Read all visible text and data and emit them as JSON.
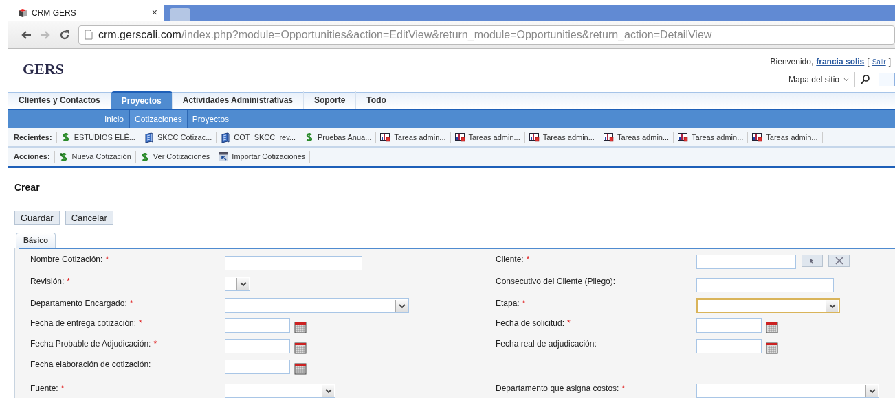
{
  "browser": {
    "tab_title": "CRM GERS",
    "tab_close": "×",
    "url_host": "crm.gerscali.com",
    "url_path": "/index.php?module=Opportunities&action=EditView&return_module=Opportunities&return_action=DetailView"
  },
  "header": {
    "logo": "GERS",
    "welcome": "Bienvenido,",
    "user": "francia solis",
    "bracket_open": "[",
    "logout": "Salir",
    "bracket_close": "]",
    "site_map": "Mapa del sitio"
  },
  "main_tabs": [
    {
      "label": "Clientes y Contactos",
      "selected": false
    },
    {
      "label": "Proyectos",
      "selected": true
    },
    {
      "label": "Actividades Administrativas",
      "selected": false
    },
    {
      "label": "Soporte",
      "selected": false
    },
    {
      "label": "Todo",
      "selected": false
    }
  ],
  "sub_tabs": [
    {
      "label": "Inicio",
      "selected": false
    },
    {
      "label": "Cotizaciones",
      "selected": true
    },
    {
      "label": "Proyectos",
      "selected": false
    }
  ],
  "recent": {
    "label": "Recientes:",
    "items": [
      {
        "kind": "quote",
        "label": "ESTUDIOS ELÉ..."
      },
      {
        "kind": "project",
        "label": "SKCC Cotizac..."
      },
      {
        "kind": "project",
        "label": "COT_SKCC_rev..."
      },
      {
        "kind": "quote",
        "label": "Pruebas Anua..."
      },
      {
        "kind": "task",
        "label": "Tareas admin..."
      },
      {
        "kind": "task",
        "label": "Tareas admin..."
      },
      {
        "kind": "task",
        "label": "Tareas admin..."
      },
      {
        "kind": "task",
        "label": "Tareas admin..."
      },
      {
        "kind": "task",
        "label": "Tareas admin..."
      },
      {
        "kind": "task",
        "label": "Tareas admin..."
      }
    ]
  },
  "actions": {
    "label": "Acciones:",
    "items": [
      {
        "kind": "new",
        "label": "Nueva Cotización"
      },
      {
        "kind": "quote",
        "label": "Ver Cotizaciones"
      },
      {
        "kind": "import",
        "label": "Importar Cotizaciones"
      }
    ]
  },
  "page_title": "Crear",
  "buttons": [
    "Guardar",
    "Cancelar"
  ],
  "form_tabs": [
    {
      "label": "Básico",
      "selected": true
    }
  ],
  "rows": [
    {
      "left": {
        "label": "Nombre Cotización:",
        "required_mark": "*",
        "kind": "text",
        "focused": false
      },
      "right": {
        "label": "Cliente:",
        "required_mark": "*",
        "kind": "relate",
        "focused": false
      }
    },
    {
      "left": {
        "label": "Revisión:",
        "required_mark": "*",
        "kind": "select",
        "focused": false
      },
      "right": {
        "label": "Consecutivo del Cliente (Pliego):",
        "kind": "text",
        "focused": false
      }
    },
    {
      "left": {
        "label": "Departamento Encargado:",
        "required_mark": "*",
        "kind": "select",
        "focused": false
      },
      "right": {
        "label": "Etapa:",
        "required_mark": "*",
        "kind": "select",
        "focused": true
      }
    },
    {
      "left": {
        "label": "Fecha de entrega cotización:",
        "required_mark": "*",
        "kind": "date",
        "focused": false
      },
      "right": {
        "label": "Fecha de solicitud:",
        "required_mark": "*",
        "kind": "date",
        "focused": false
      }
    },
    {
      "left": {
        "label": "Fecha Probable de Adjudicación:",
        "required_mark": "*",
        "kind": "date",
        "focused": false
      },
      "right": {
        "label": "Fecha real de adjudicación:",
        "kind": "date",
        "focused": false
      }
    },
    {
      "left": {
        "label": "Fecha elaboración de cotización:",
        "kind": "date",
        "focused": false
      }
    },
    {
      "left": {
        "label": "Fuente:",
        "required_mark": "*",
        "kind": "select",
        "focused": false
      },
      "right": {
        "label": "Departamento que asigna costos:",
        "required_mark": "*",
        "kind": "select",
        "focused": false
      }
    }
  ]
}
